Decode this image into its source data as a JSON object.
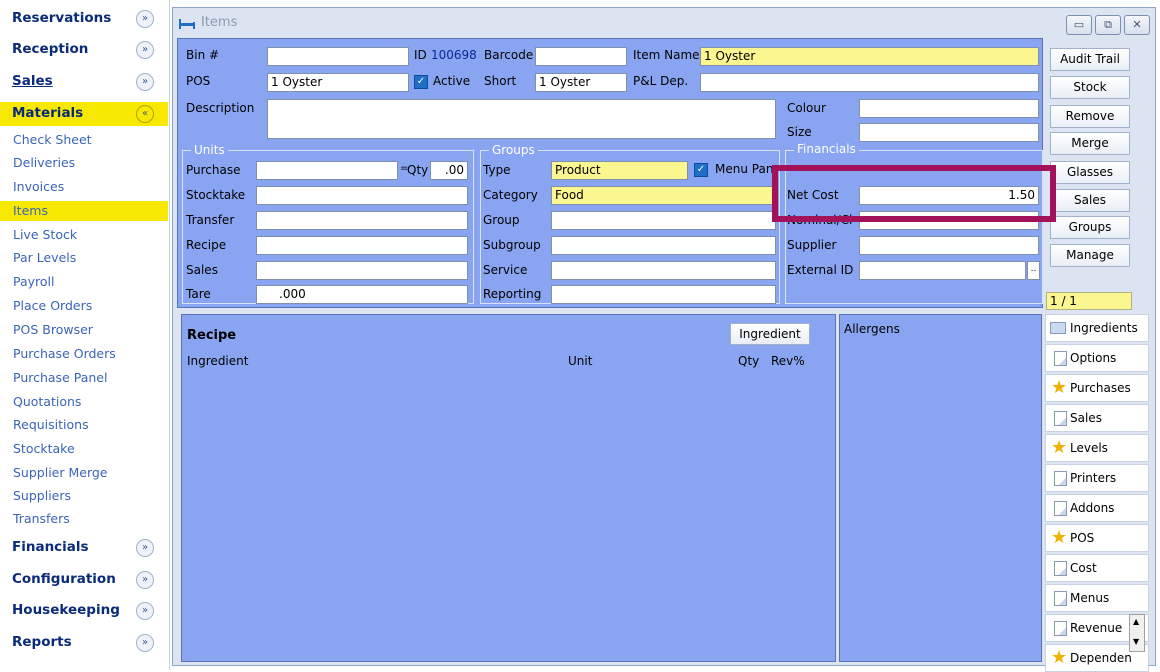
{
  "sidebar": {
    "sections_top": [
      {
        "label": "Reservations"
      },
      {
        "label": "Reception"
      },
      {
        "label": "Sales"
      },
      {
        "label": "Materials"
      }
    ],
    "items": [
      "Check Sheet",
      "Deliveries",
      "Invoices",
      "Items",
      "Live Stock",
      "Par Levels",
      "Payroll",
      "Place Orders",
      "POS Browser",
      "Purchase Orders",
      "Purchase Panel",
      "Quotations",
      "Requisitions",
      "Stocktake",
      "Supplier Merge",
      "Suppliers",
      "Transfers"
    ],
    "sections_bottom": [
      {
        "label": "Financials"
      },
      {
        "label": "Configuration"
      },
      {
        "label": "Housekeeping"
      },
      {
        "label": "Reports"
      }
    ],
    "collapse_glyph": "«",
    "expand_glyph": "»"
  },
  "window": {
    "title": "Items",
    "min": "▭",
    "max": "⧉",
    "close": "✕"
  },
  "form": {
    "bin_label": "Bin #",
    "bin_value": "",
    "id_label": "ID",
    "id_value": "100698",
    "barcode_label": "Barcode",
    "barcode_value": "",
    "itemname_label": "Item Name",
    "itemname_value": "1 Oyster",
    "pos_label": "POS",
    "pos_value": "1 Oyster",
    "active_label": "Active",
    "short_label": "Short",
    "short_value": "1 Oyster",
    "pl_label": "P&L Dep.",
    "pl_value": "",
    "description_label": "Description",
    "description_value": "",
    "colour_label": "Colour",
    "size_label": "Size"
  },
  "units": {
    "title": "Units",
    "purchase": "Purchase",
    "eq": "=",
    "qty_label": "Qty",
    "qty_value": ".00",
    "stocktake": "Stocktake",
    "transfer": "Transfer",
    "recipe": "Recipe",
    "sales": "Sales",
    "tare": "Tare",
    "tare_value": ".000"
  },
  "groups": {
    "title": "Groups",
    "type": "Type",
    "type_value": "Product",
    "menu_panel": "Menu Pan",
    "category": "Category",
    "category_value": "Food",
    "group": "Group",
    "subgroup": "Subgroup",
    "service": "Service",
    "reporting": "Reporting"
  },
  "financials": {
    "title": "Financials",
    "net_cost": "Net Cost",
    "net_cost_value": "1.50",
    "nominal": "Nominal/Cl",
    "supplier": "Supplier",
    "external_id": "External ID",
    "ellipsis": ".."
  },
  "buttons": [
    "Audit Trail",
    "Stock",
    "Remove",
    "Merge",
    "Glasses",
    "Sales",
    "Groups",
    "Manage"
  ],
  "counter": "1 / 1",
  "recipe": {
    "title": "Recipe",
    "ingredient_button": "Ingredient",
    "col_ingredient": "Ingredient",
    "col_unit": "Unit",
    "col_qty": "Qty",
    "col_rev": "Rev%"
  },
  "allergens": {
    "title": "Allergens"
  },
  "tabs": [
    {
      "label": "Ingredients",
      "icon": "chat-icon"
    },
    {
      "label": "Options",
      "icon": "page-icon"
    },
    {
      "label": "Purchases",
      "icon": "star-icon"
    },
    {
      "label": "Sales",
      "icon": "page-icon"
    },
    {
      "label": "Levels",
      "icon": "star-icon"
    },
    {
      "label": "Printers",
      "icon": "page-icon"
    },
    {
      "label": "Addons",
      "icon": "page-icon"
    },
    {
      "label": "POS",
      "icon": "star-icon"
    },
    {
      "label": "Cost",
      "icon": "page-icon"
    },
    {
      "label": "Menus",
      "icon": "page-icon"
    },
    {
      "label": "Revenue",
      "icon": "page-icon"
    },
    {
      "label": "Dependen",
      "icon": "star-icon"
    }
  ],
  "colors": {
    "accent": "#f6e800",
    "highlight": "#a3115b",
    "panel": "#89a5f1"
  }
}
